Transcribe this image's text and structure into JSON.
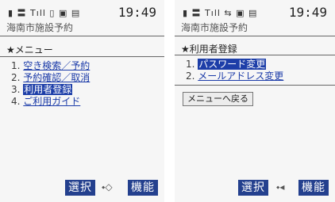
{
  "left": {
    "status_icons": "▮ 〓 Tıll ▯ ▣ ▤",
    "clock": "19:49",
    "site_title": "海南市施設予約",
    "section_title": "★メニュー",
    "menu": [
      {
        "number": "1.",
        "label": "空き検索／予約"
      },
      {
        "number": "2.",
        "label": "予約確認／取消"
      },
      {
        "number": "3.",
        "label": "利用者登録"
      },
      {
        "number": "4.",
        "label": "ご利用ガイド"
      }
    ],
    "softkey_select": "選択",
    "softkey_function": "機能",
    "nav_icon": "⬩◇"
  },
  "right": {
    "status_icons": "▮ 〓 Tıll ⇆ ▣ ▤",
    "clock": "19:49",
    "site_title": "海南市施設予約",
    "section_title": "★利用者登録",
    "menu": [
      {
        "number": "1.",
        "label": "パスワード変更"
      },
      {
        "number": "2.",
        "label": "メールアドレス変更"
      }
    ],
    "back_button": "メニューへ戻る",
    "softkey_select": "選択",
    "softkey_function": "機能",
    "nav_icon": "⬩◂"
  },
  "colors": {
    "link": "#1a3aa8",
    "highlight": "#1d3ea8",
    "softkey": "#24408e"
  }
}
